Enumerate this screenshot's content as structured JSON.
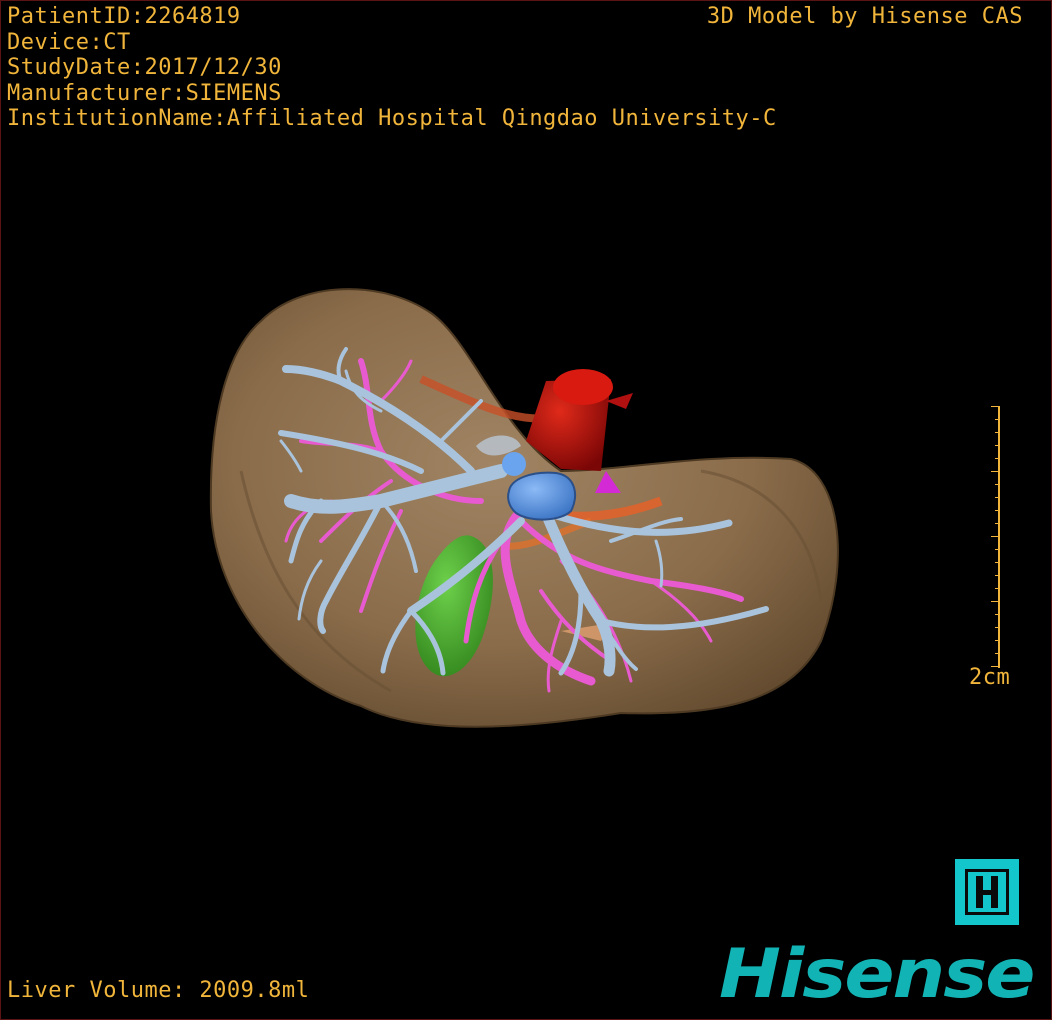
{
  "header": {
    "patient_id": "PatientID:2264819",
    "device": "Device:CT",
    "study_date": "StudyDate:2017/12/30",
    "manufacturer": "Manufacturer:SIEMENS",
    "institution": "InstitutionName:Affiliated Hospital Qingdao University-C"
  },
  "vendor_credit": "3D Model by Hisense CAS",
  "measurements": {
    "liver_volume": "Liver Volume: 2009.8ml"
  },
  "scale_bar": {
    "label": "2cm"
  },
  "brand": {
    "wordmark": "Hisense",
    "logo_letter": "H"
  },
  "colors": {
    "overlay_text": "#f0b53a",
    "liver": "#8b6d4b",
    "portal_vein": "#a9c3dc",
    "hepatic_artery": "#e85ad0",
    "vena_cava": "#c41212",
    "gallbladder": "#46c02c",
    "tumor": "#5c98ea",
    "brand_teal": "#12b3b4"
  },
  "model_structures": [
    {
      "name": "Liver parenchyma",
      "color": "#8b6d4b"
    },
    {
      "name": "Portal vein",
      "color": "#a9c3dc"
    },
    {
      "name": "Hepatic artery",
      "color": "#e85ad0"
    },
    {
      "name": "Inferior vena cava",
      "color": "#c41212"
    },
    {
      "name": "Gallbladder",
      "color": "#46c02c"
    },
    {
      "name": "Lesion",
      "color": "#5c98ea"
    }
  ]
}
